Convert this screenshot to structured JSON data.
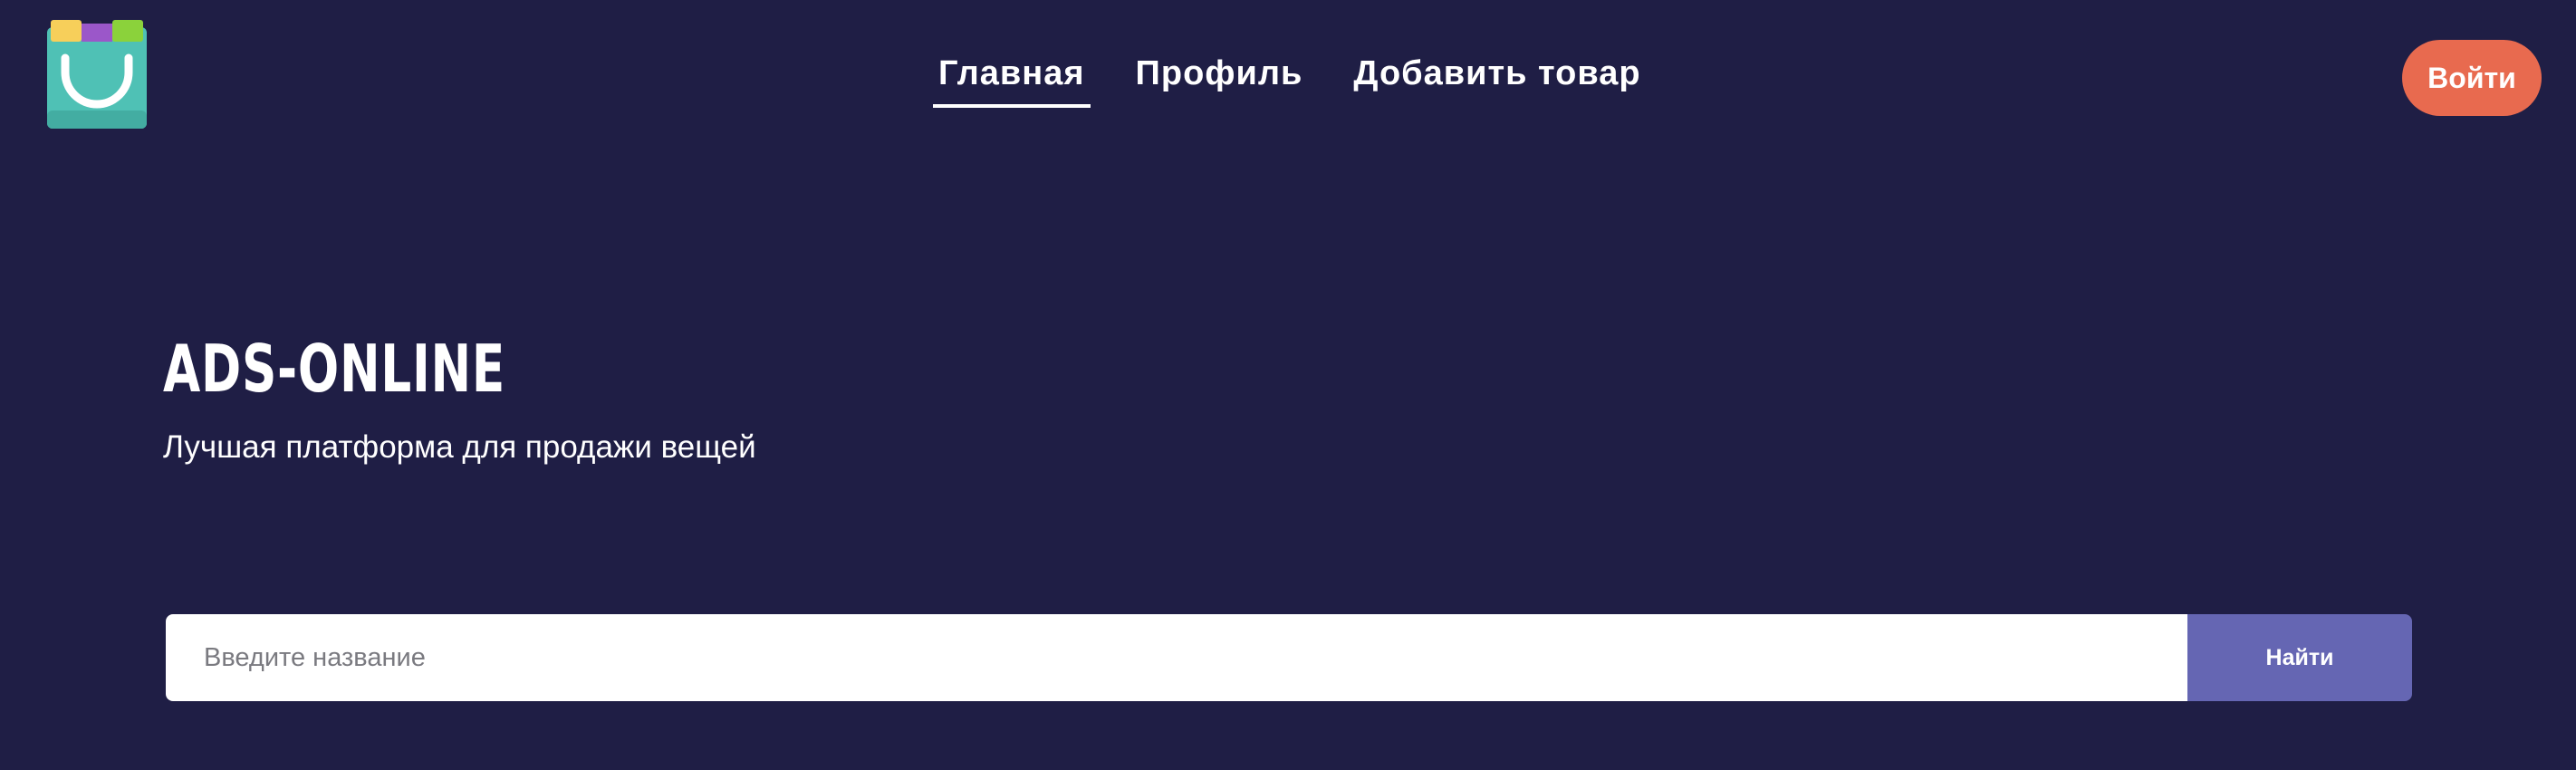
{
  "header": {
    "logo_icon": "shopping-bag-icon",
    "nav": [
      {
        "label": "Главная",
        "active": true
      },
      {
        "label": "Профиль",
        "active": false
      },
      {
        "label": "Добавить товар",
        "active": false
      }
    ],
    "login_label": "Войти"
  },
  "hero": {
    "title": "ADS-ONLINE",
    "subtitle": "Лучшая платформа для продажи вещей"
  },
  "search": {
    "placeholder": "Введите название",
    "value": "",
    "button_label": "Найти"
  },
  "colors": {
    "background": "#1f1e45",
    "accent_login": "#e86a4f",
    "search_button": "#6566b3",
    "logo_bag": "#4fc1b5"
  }
}
